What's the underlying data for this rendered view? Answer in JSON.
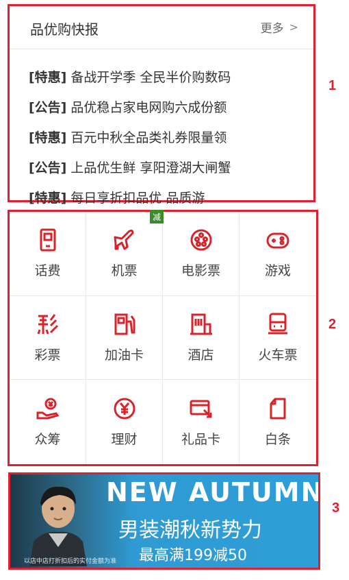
{
  "news": {
    "title": "品优购快报",
    "more_label": "更多",
    "items": [
      {
        "tag": "[特惠]",
        "text": "备战开学季 全民半价购数码"
      },
      {
        "tag": "[公告]",
        "text": "品优稳占家电网购六成份额"
      },
      {
        "tag": "[特惠]",
        "text": "百元中秋全品类礼券限量领"
      },
      {
        "tag": "[公告]",
        "text": "上品优生鲜 享阳澄湖大闸蟹"
      },
      {
        "tag": "[特惠]",
        "text": "每日享折扣品优 品质游"
      }
    ]
  },
  "services": {
    "badge": "减",
    "items": [
      {
        "label": "话费",
        "icon": "phone-icon"
      },
      {
        "label": "机票",
        "icon": "airplane-icon"
      },
      {
        "label": "电影票",
        "icon": "film-reel-icon"
      },
      {
        "label": "游戏",
        "icon": "gamepad-icon"
      },
      {
        "label": "彩票",
        "icon": "lottery-icon"
      },
      {
        "label": "加油卡",
        "icon": "gas-pump-icon"
      },
      {
        "label": "酒店",
        "icon": "hotel-building-icon"
      },
      {
        "label": "火车票",
        "icon": "train-icon"
      },
      {
        "label": "众筹",
        "icon": "crowdfund-hand-icon"
      },
      {
        "label": "理财",
        "icon": "yuan-coin-icon"
      },
      {
        "label": "礼品卡",
        "icon": "gift-card-icon"
      },
      {
        "label": "白条",
        "icon": "document-icon"
      }
    ],
    "accent_color": "#d8232a"
  },
  "banner": {
    "headline": "NEW AUTUMN",
    "subhead": "男装潮秋新势力",
    "promo": "最高满199减50",
    "fine_print": "以店中店打折扣后的实付金额为准"
  },
  "markers": [
    "1",
    "2",
    "3"
  ],
  "colors": {
    "frame": "#e02030",
    "banner_blue": "#2d9fd8"
  }
}
